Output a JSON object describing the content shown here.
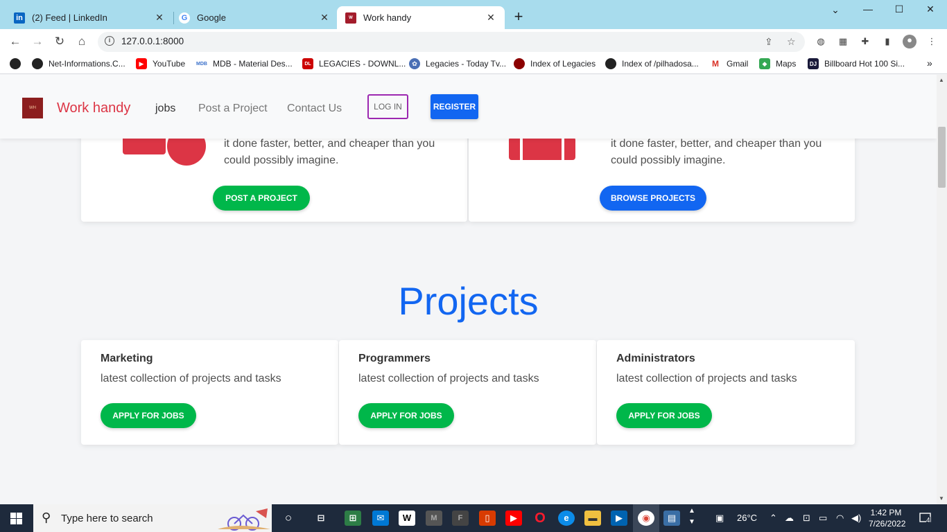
{
  "browser": {
    "tabs": [
      {
        "title": "(2) Feed | LinkedIn",
        "icon": "linkedin-icon"
      },
      {
        "title": "Google",
        "icon": "google-icon"
      },
      {
        "title": "Work handy",
        "icon": "workhandy-icon"
      }
    ],
    "url": "127.0.0.1:8000",
    "bookmarks": [
      {
        "label": "Net-Informations.C...",
        "icon": "web-icon"
      },
      {
        "label": "YouTube",
        "icon": "youtube-icon"
      },
      {
        "label": "MDB - Material Des...",
        "icon": "mdb-icon"
      },
      {
        "label": "LEGACIES - DOWNL...",
        "icon": "legacies-icon"
      },
      {
        "label": "Legacies - Today Tv...",
        "icon": "film-icon"
      },
      {
        "label": "Index of Legacies",
        "icon": "globe-red-icon"
      },
      {
        "label": "Index of /pilhadosa...",
        "icon": "web-icon"
      },
      {
        "label": "Gmail",
        "icon": "gmail-icon"
      },
      {
        "label": "Maps",
        "icon": "maps-icon"
      },
      {
        "label": "Billboard Hot 100 Si...",
        "icon": "dj-icon"
      }
    ]
  },
  "site": {
    "brand": "Work handy",
    "nav": {
      "jobs": "jobs",
      "post": "Post a Project",
      "contact": "Contact Us",
      "login": "LOG IN",
      "register": "REGISTER"
    },
    "features": [
      {
        "line1": "it done faster, better, and cheaper than you",
        "line2": "could possibly imagine.",
        "button": "POST A PROJECT"
      },
      {
        "line1": "it done faster, better, and cheaper than you",
        "line2": "could possibly imagine.",
        "button": "BROWSE PROJECTS"
      }
    ],
    "projects_title": "Projects",
    "projects": [
      {
        "title": "Marketing",
        "text": "latest collection of projects and tasks",
        "button": "APPLY FOR JOBS"
      },
      {
        "title": "Programmers",
        "text": "latest collection of projects and tasks",
        "button": "APPLY FOR JOBS"
      },
      {
        "title": "Administrators",
        "text": "latest collection of projects and tasks",
        "button": "APPLY FOR JOBS"
      }
    ]
  },
  "taskbar": {
    "search_placeholder": "Type here to search",
    "weather": "26°C",
    "time": "1:42 PM",
    "date": "7/26/2022",
    "notifications": "4"
  },
  "colors": {
    "brand_red": "#dc3545",
    "primary_blue": "#1266f1",
    "success_green": "#00b74a",
    "login_border": "#9c27b0"
  }
}
